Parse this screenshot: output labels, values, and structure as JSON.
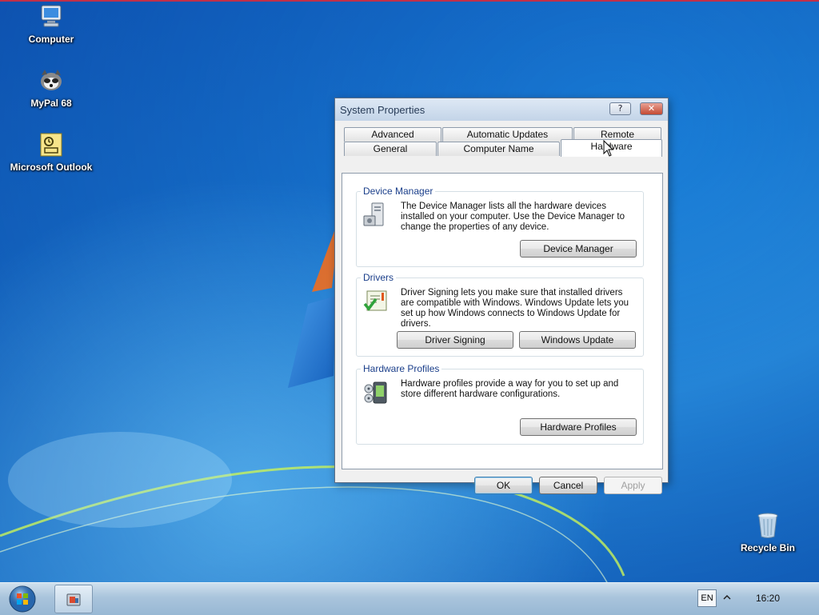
{
  "desktop": {
    "icons": [
      {
        "label": "Computer",
        "icon": "computer-icon"
      },
      {
        "label": "MyPal 68",
        "icon": "mypal-icon"
      },
      {
        "label": "Microsoft Outlook",
        "icon": "outlook-icon"
      }
    ],
    "recycle_bin": {
      "label": "Recycle Bin",
      "icon": "recycle-bin-icon"
    }
  },
  "dialog": {
    "title": "System Properties",
    "help_glyph": "?",
    "close_glyph": "✕",
    "tabs_row1": [
      {
        "label": "Advanced"
      },
      {
        "label": "Automatic Updates"
      },
      {
        "label": "Remote"
      }
    ],
    "tabs_row2": [
      {
        "label": "General"
      },
      {
        "label": "Computer Name"
      },
      {
        "label": "Hardware",
        "active": true
      }
    ],
    "groups": {
      "device_manager": {
        "title": "Device Manager",
        "text": "The Device Manager lists all the hardware devices installed on your computer. Use the Device Manager to change the properties of any device.",
        "button": "Device Manager"
      },
      "drivers": {
        "title": "Drivers",
        "text": "Driver Signing lets you make sure that installed drivers are compatible with Windows. Windows Update lets you set up how Windows connects to Windows Update for drivers.",
        "button_signing": "Driver Signing",
        "button_update": "Windows Update"
      },
      "hardware_profiles": {
        "title": "Hardware Profiles",
        "text": "Hardware profiles provide a way for you to set up and store different hardware configurations.",
        "button": "Hardware Profiles"
      }
    },
    "buttons": {
      "ok": "OK",
      "cancel": "Cancel",
      "apply": "Apply"
    }
  },
  "taskbar": {
    "language": "EN",
    "clock": "16:20"
  },
  "colors": {
    "accent_blue": "#1a3e8a",
    "desktop_blue": "#1a7fd8",
    "close_red": "#c44a33"
  }
}
